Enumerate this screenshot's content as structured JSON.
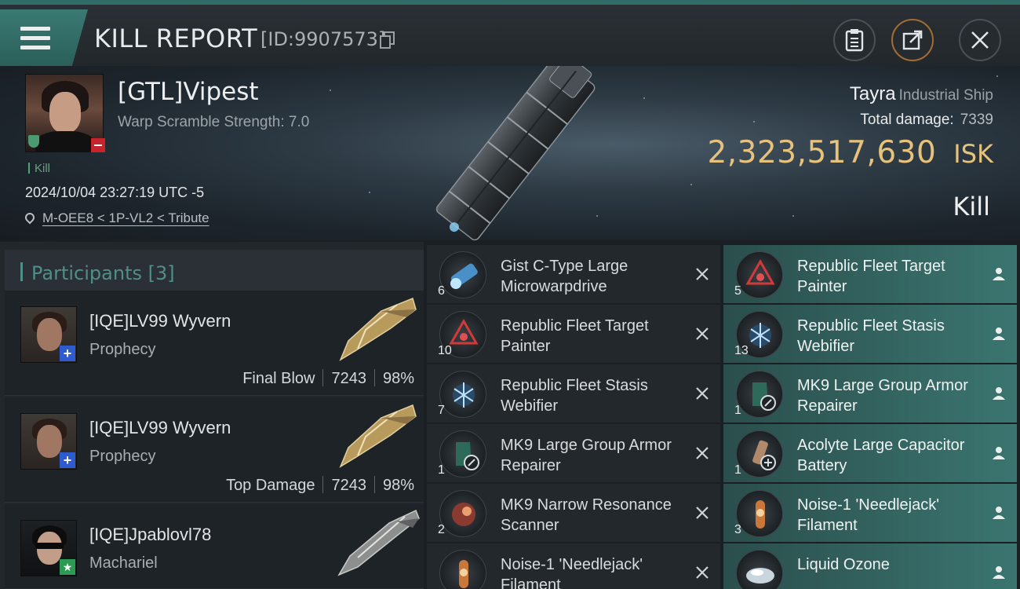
{
  "header": {
    "title": "KILL REPORT",
    "report_id": "[ID:9907573]",
    "icons": [
      "menu-icon",
      "copy-icon",
      "clipboard-icon",
      "share-icon",
      "close-icon"
    ]
  },
  "victim": {
    "name": "[GTL]Vipest",
    "warp": "Warp Scramble Strength: 7.0",
    "kill_tag": "Kill",
    "datetime": "2024/10/04 23:27:19 UTC -5",
    "location": "M-OEE8 < 1P-VL2 < Tribute",
    "ship_name": "Tayra",
    "ship_class": "Industrial Ship",
    "total_damage_label": "Total damage:",
    "total_damage": "7339",
    "isk_value": "2,323,517,630",
    "isk_unit": "ISK",
    "result": "Kill"
  },
  "participants": {
    "label": "Participants",
    "count": "[3]",
    "items": [
      {
        "name": "[IQE]LV99 Wyvern",
        "ship": "Prophecy",
        "role": "Final Blow",
        "damage": "7243",
        "percent": "98%"
      },
      {
        "name": "[IQE]LV99 Wyvern",
        "ship": "Prophecy",
        "role": "Top Damage",
        "damage": "7243",
        "percent": "98%"
      },
      {
        "name": "[IQE]Jpablovl78",
        "ship": "Machariel",
        "role": "",
        "damage": "",
        "percent": ""
      }
    ]
  },
  "modules": {
    "left": [
      {
        "qty": "6",
        "name": "Gist C-Type Large Microwarpdrive",
        "icon": "microwarpdrive-icon"
      },
      {
        "qty": "10",
        "name": "Republic Fleet Target Painter",
        "icon": "target-painter-icon"
      },
      {
        "qty": "7",
        "name": "Republic Fleet Stasis Webifier",
        "icon": "stasis-webifier-icon"
      },
      {
        "qty": "1",
        "name": "MK9 Large Group Armor Repairer",
        "icon": "armor-repairer-icon"
      },
      {
        "qty": "2",
        "name": "MK9 Narrow Resonance Scanner",
        "icon": "resonance-scanner-icon"
      },
      {
        "qty": "",
        "name": "Noise-1 'Needlejack' Filament",
        "icon": "filament-icon"
      }
    ],
    "right": [
      {
        "qty": "5",
        "name": "Republic Fleet Target Painter",
        "icon": "target-painter-icon"
      },
      {
        "qty": "13",
        "name": "Republic Fleet Stasis Webifier",
        "icon": "stasis-webifier-icon"
      },
      {
        "qty": "1",
        "name": "MK9 Large Group Armor Repairer",
        "icon": "armor-repairer-icon"
      },
      {
        "qty": "1",
        "name": "Acolyte Large Capacitor Battery",
        "icon": "capacitor-battery-icon"
      },
      {
        "qty": "3",
        "name": "Noise-1 'Needlejack' Filament",
        "icon": "filament-icon"
      },
      {
        "qty": "",
        "name": "Liquid Ozone",
        "icon": "liquid-ozone-icon"
      }
    ]
  },
  "colors": {
    "accent": "#3a7a73",
    "isk_gold": "#e7c27c",
    "destroyed_bg": "#3b7570",
    "dropped_bg": "#23282c"
  }
}
